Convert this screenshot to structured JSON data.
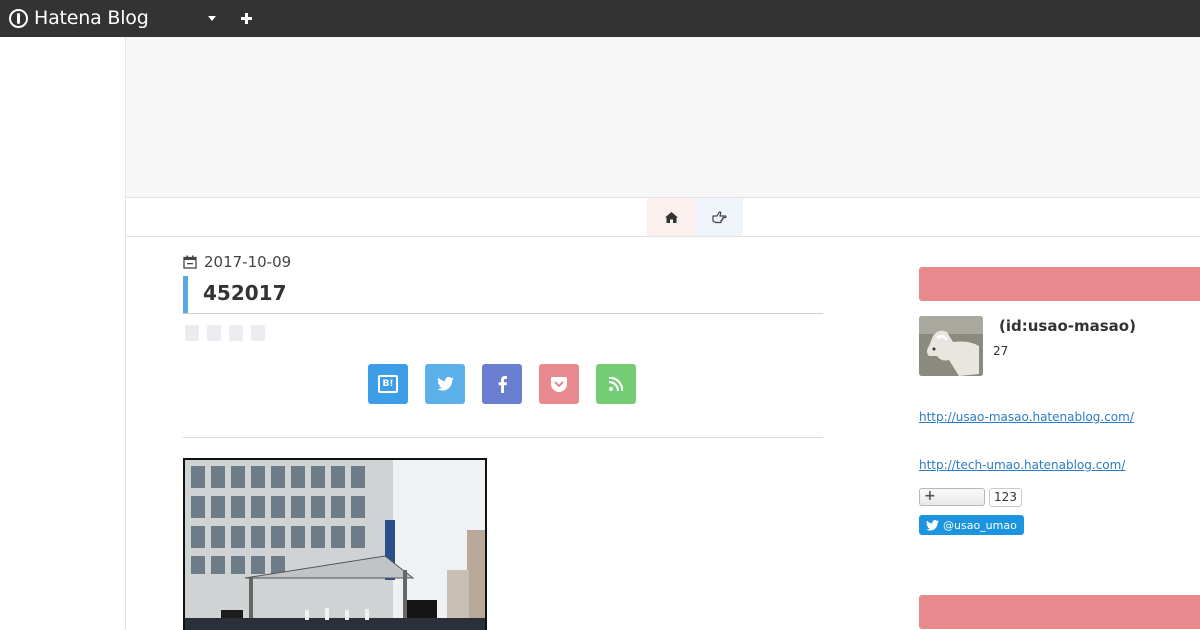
{
  "topbar": {
    "brand": "Hatena Blog",
    "menu_icon": "caret-down-icon",
    "add_icon": "plus-icon"
  },
  "nav": {
    "home_icon": "home-icon",
    "pick_icon": "hand-pointer-icon"
  },
  "article": {
    "date": "2017-10-09",
    "title": "452017",
    "share_buttons": [
      "hatena-bookmark-icon",
      "twitter-icon",
      "facebook-icon",
      "pocket-icon",
      "feed-icon"
    ],
    "hatena_mark": "B!"
  },
  "sidebar": {
    "profile_id": "(id:usao-masao)",
    "profile_count": "27",
    "links": [
      "http://usao-masao.hatenablog.com/",
      "http://tech-umao.hatenablog.com/"
    ],
    "subscribe_count": "123",
    "twitter_follow": "@usao_umao"
  },
  "colors": {
    "topbar": "#333333",
    "sidebar_heading": "#e88a8d",
    "title_accent": "#5aa9de",
    "link": "#2a7dc4"
  }
}
